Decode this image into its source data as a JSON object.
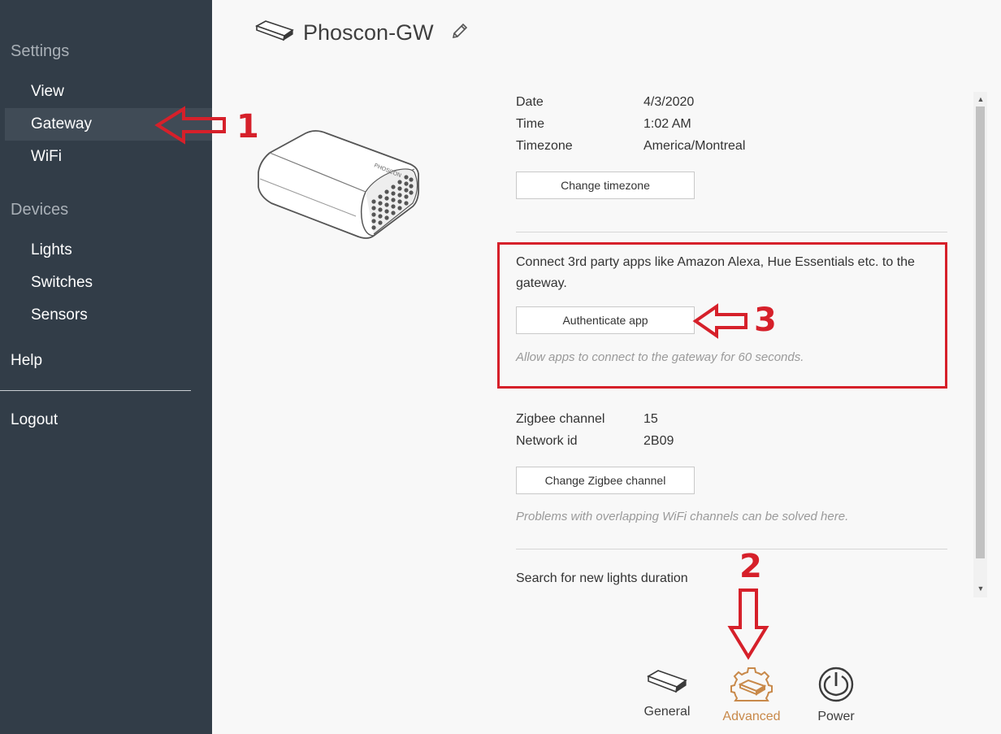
{
  "sidebar": {
    "settings_heading": "Settings",
    "settings_items": [
      {
        "label": "View"
      },
      {
        "label": "Gateway"
      },
      {
        "label": "WiFi"
      }
    ],
    "devices_heading": "Devices",
    "devices_items": [
      {
        "label": "Lights"
      },
      {
        "label": "Switches"
      },
      {
        "label": "Sensors"
      }
    ],
    "help_label": "Help",
    "logout_label": "Logout",
    "active_item": "Gateway"
  },
  "header": {
    "title": "Phoscon-GW",
    "icon": "gateway-icon",
    "edit_icon": "pencil-icon"
  },
  "gateway_illustration": {
    "brand_text": "PHOSCON"
  },
  "datetime": {
    "date_label": "Date",
    "date_value": "4/3/2020",
    "time_label": "Time",
    "time_value": "1:02 AM",
    "timezone_label": "Timezone",
    "timezone_value": "America/Montreal",
    "change_timezone_button": "Change timezone"
  },
  "authenticate": {
    "description": "Connect 3rd party apps like Amazon Alexa, Hue Essentials etc. to the gateway.",
    "button": "Authenticate app",
    "hint": "Allow apps to connect to the gateway for 60 seconds."
  },
  "zigbee": {
    "channel_label": "Zigbee channel",
    "channel_value": "15",
    "network_label": "Network id",
    "network_value": "2B09",
    "change_channel_button": "Change Zigbee channel",
    "hint": "Problems with overlapping WiFi channels can be solved here."
  },
  "search": {
    "duration_label": "Search for new lights duration"
  },
  "bottom_tabs": [
    {
      "label": "General",
      "icon": "gateway-icon"
    },
    {
      "label": "Advanced",
      "icon": "gear-gateway-icon"
    },
    {
      "label": "Power",
      "icon": "power-icon"
    }
  ],
  "active_tab": "Advanced",
  "annotations": {
    "step1": "1",
    "step2": "2",
    "step3": "3"
  },
  "colors": {
    "sidebar_bg": "#323d48",
    "annotation_red": "#d6202a",
    "active_tab": "#c8894a"
  }
}
